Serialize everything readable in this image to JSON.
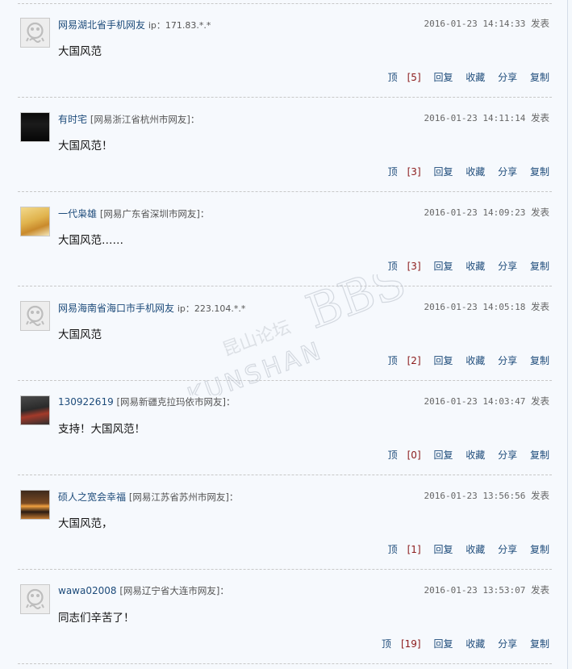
{
  "posts": [
    {
      "author": "网易湖北省手机网友",
      "location": "",
      "ip": "ip：171.83.*.*",
      "time": "2016-01-23 14:14:33",
      "time_suffix": "发表",
      "content": "大国风范",
      "votes_label": "顶",
      "votes": "[5]",
      "avatar": "default",
      "actions": [
        "回复",
        "收藏",
        "分享",
        "复制"
      ]
    },
    {
      "author": "有时宅",
      "location": "[网易浙江省杭州市网友]：",
      "ip": "",
      "time": "2016-01-23 14:11:14",
      "time_suffix": "发表",
      "content": "大国风范！",
      "votes_label": "顶",
      "votes": "[3]",
      "avatar": "photo-dark",
      "actions": [
        "回复",
        "收藏",
        "分享",
        "复制"
      ]
    },
    {
      "author": "一代枭雄",
      "location": "[网易广东省深圳市网友]：",
      "ip": "",
      "time": "2016-01-23 14:09:23",
      "time_suffix": "发表",
      "content": "大国风范……",
      "votes_label": "顶",
      "votes": "[3]",
      "avatar": "photo-emperor",
      "actions": [
        "回复",
        "收藏",
        "分享",
        "复制"
      ]
    },
    {
      "author": "网易海南省海口市手机网友",
      "location": "",
      "ip": "ip：223.104.*.*",
      "time": "2016-01-23 14:05:18",
      "time_suffix": "发表",
      "content": "大国风范",
      "votes_label": "顶",
      "votes": "[2]",
      "avatar": "default",
      "actions": [
        "回复",
        "收藏",
        "分享",
        "复制"
      ]
    },
    {
      "author": "130922619",
      "location": "[网易新疆克拉玛依市网友]：",
      "ip": "",
      "time": "2016-01-23 14:03:47",
      "time_suffix": "发表",
      "content": "支持！大国风范！",
      "votes_label": "顶",
      "votes": "[0]",
      "avatar": "photo-car",
      "actions": [
        "回复",
        "收藏",
        "分享",
        "复制"
      ]
    },
    {
      "author": "硕人之宽会幸福",
      "location": "[网易江苏省苏州市网友]：",
      "ip": "",
      "time": "2016-01-23 13:56:56",
      "time_suffix": "发表",
      "content": "大国风范，",
      "votes_label": "顶",
      "votes": "[1]",
      "avatar": "photo-city",
      "actions": [
        "回复",
        "收藏",
        "分享",
        "复制"
      ]
    },
    {
      "author": "wawa02008",
      "location": "[网易辽宁省大连市网友]：",
      "ip": "",
      "time": "2016-01-23 13:53:07",
      "time_suffix": "发表",
      "content": "同志们辛苦了！",
      "votes_label": "顶",
      "votes": "[19]",
      "avatar": "default",
      "actions": [
        "回复",
        "收藏",
        "分享",
        "复制"
      ]
    }
  ],
  "watermark": {
    "cn": "昆山论坛",
    "bbs": "BBS",
    "en": "KUNSHAN"
  }
}
